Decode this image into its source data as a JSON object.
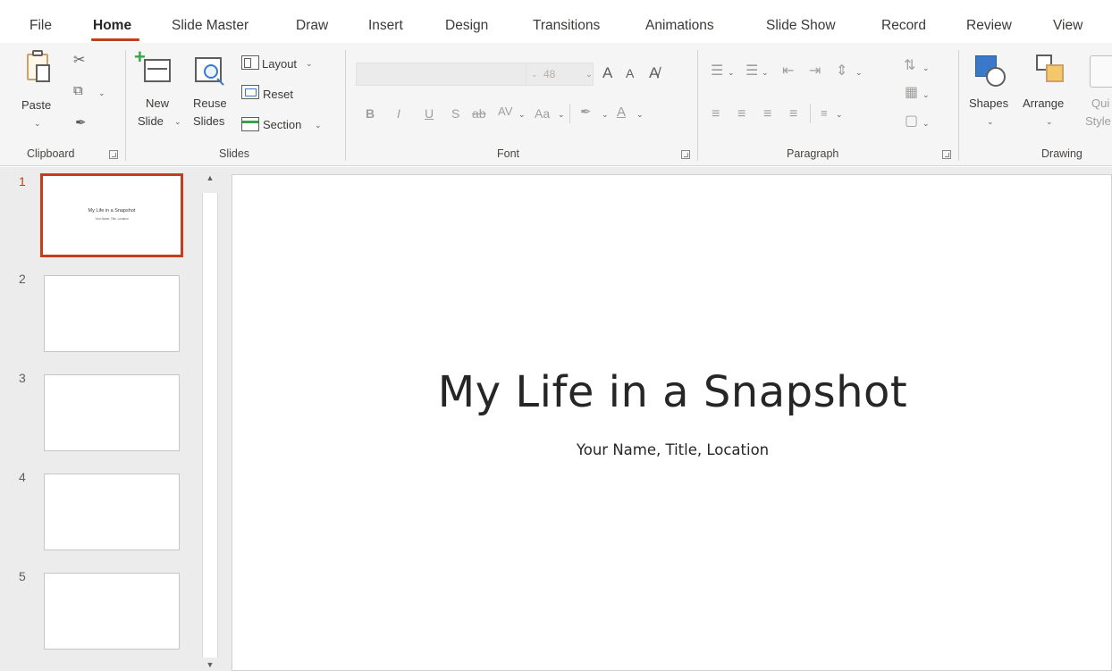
{
  "tabs": [
    {
      "label": "File"
    },
    {
      "label": "Home",
      "active": true
    },
    {
      "label": "Slide Master"
    },
    {
      "label": "Draw"
    },
    {
      "label": "Insert"
    },
    {
      "label": "Design"
    },
    {
      "label": "Transitions"
    },
    {
      "label": "Animations"
    },
    {
      "label": "Slide Show"
    },
    {
      "label": "Record"
    },
    {
      "label": "Review"
    },
    {
      "label": "View"
    }
  ],
  "ribbon": {
    "clipboard": {
      "paste_label": "Paste",
      "group_label": "Clipboard"
    },
    "slides": {
      "new_slide_label_1": "New",
      "new_slide_label_2": "Slide",
      "reuse_label_1": "Reuse",
      "reuse_label_2": "Slides",
      "layout_label": "Layout",
      "reset_label": "Reset",
      "section_label": "Section",
      "group_label": "Slides"
    },
    "font": {
      "font_name_value": "",
      "font_size_value": "48",
      "bold": "B",
      "italic": "I",
      "underline": "U",
      "shadow": "S",
      "strike": "ab",
      "spacing": "AV",
      "change_case": "Aa",
      "font_color": "A",
      "grow": "A",
      "shrink": "A",
      "group_label": "Font"
    },
    "paragraph": {
      "group_label": "Paragraph"
    },
    "drawing": {
      "shapes_label": "Shapes",
      "arrange_label": "Arrange",
      "quick_styles_label_1": "Qui",
      "quick_styles_label_2": "Style",
      "group_label": "Drawing"
    }
  },
  "thumbnails": [
    {
      "number": "1",
      "active": true,
      "title": "My Life in a Snapshot",
      "subtitle": "Your Name, Title, Location"
    },
    {
      "number": "2"
    },
    {
      "number": "3"
    },
    {
      "number": "4"
    },
    {
      "number": "5"
    }
  ],
  "slide": {
    "title": "My Life in a Snapshot",
    "subtitle": "Your Name, Title, Location"
  },
  "colors": {
    "accent": "#c43e1c",
    "ribbon_bg": "#f5f5f5",
    "pane_bg": "#ececec"
  }
}
